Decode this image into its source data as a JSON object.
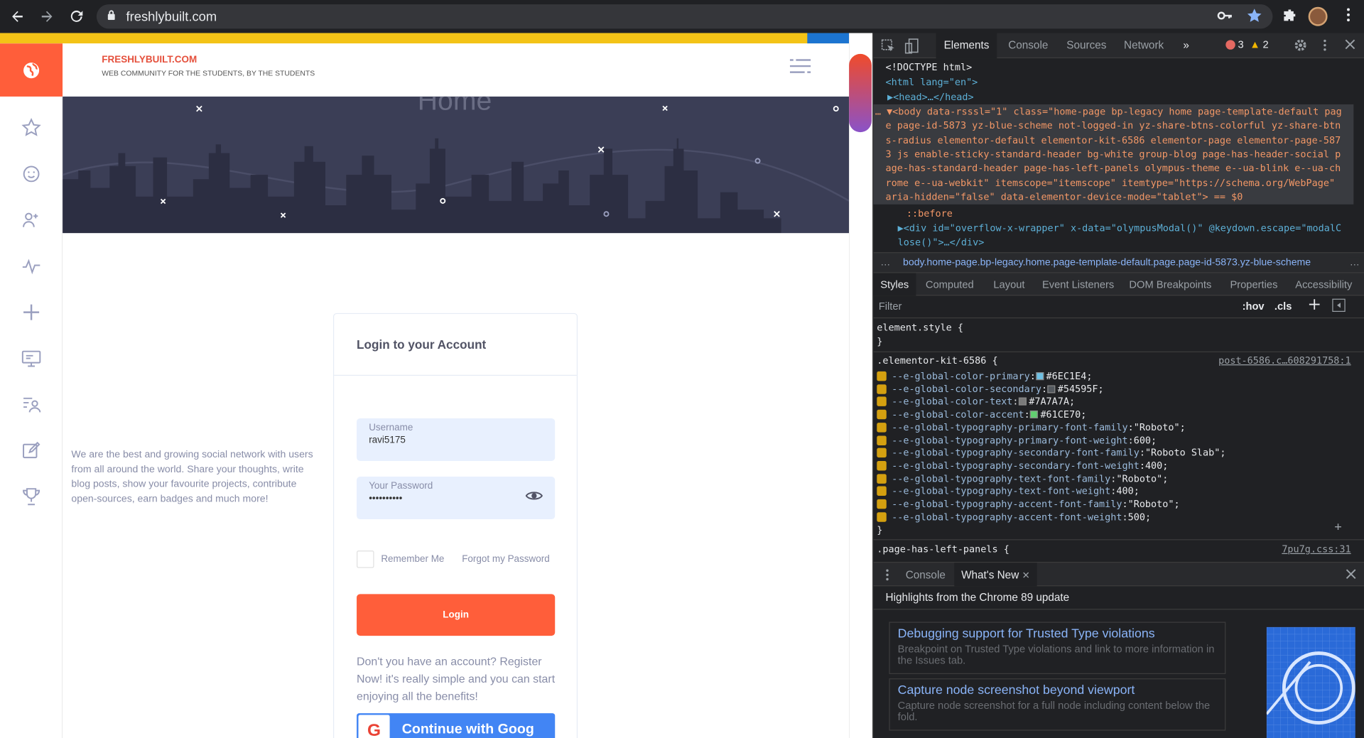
{
  "browser": {
    "url": "freshlybuilt.com"
  },
  "site": {
    "brand": "FRESHLYBUILT.COM",
    "tagline": "WEB COMMUNITY FOR THE STUDENTS, BY THE STUDENTS",
    "hero_title": "Home",
    "about": "We are the best and growing social network with users from all around the world. Share your thoughts, write blog posts, show your favourite projects, contribute open-sources, earn badges and much more!",
    "login": {
      "title": "Login to your Account",
      "username_label": "Username",
      "username_value": "ravi5175",
      "password_label": "Your Password",
      "password_value": "••••••••••",
      "remember": "Remember Me",
      "forgot": "Forgot my Password",
      "button": "Login",
      "register_text": "Don't you have an account? Register Now! it's really simple and you can start enjoying all the benefits!",
      "google_button": "Continue with Goog"
    },
    "colors": {
      "accent": "#ff5e3a",
      "hero": "#3b3e56",
      "topbar": "#f3c317"
    }
  },
  "devtools": {
    "tabs": [
      "Elements",
      "Console",
      "Sources",
      "Network"
    ],
    "active_tab": "Elements",
    "more_tabs": "»",
    "errors": "3",
    "warnings": "2",
    "elements_lines": [
      "<!DOCTYPE html>",
      "<html lang=\"en\">",
      "▶<head>…</head>",
      "… ▼<body data-rsssl=\"1\" class=\"home-page bp-legacy home page-template-default pag",
      "e page-id-5873 yz-blue-scheme not-logged-in yz-share-btns-colorful yz-share-btn",
      "s-radius elementor-default elementor-kit-6586 elementor-page elementor-page-587",
      "3 js enable-sticky-standard-header bg-white group-blog page-has-header-social p",
      "age-has-standard-header page-has-left-panels olympus-theme e--ua-blink e--ua-ch",
      "rome e--ua-webkit\" itemscope=\"itemscope\" itemtype=\"https://schema.org/WebPage\"",
      "aria-hidden=\"false\" data-elementor-device-mode=\"tablet\"> == $0",
      "::before",
      "▶<div id=\"overflow-x-wrapper\" x-data=\"olympusModal()\" @keydown.escape=\"modalC",
      "lose()\">…</div>"
    ],
    "breadcrumb": "body.home-page.bp-legacy.home.page-template-default.page.page-id-5873.yz-blue-scheme",
    "breadcrumb_lead": "…",
    "breadcrumb_trail": "…",
    "sub_tabs": [
      "Styles",
      "Computed",
      "Layout",
      "Event Listeners",
      "DOM Breakpoints",
      "Properties",
      "Accessibility"
    ],
    "filter_placeholder": "Filter",
    "hov": ":hov",
    "cls": ".cls",
    "element_style": "element.style {",
    "close_brace": "}",
    "rule_selector": ".elementor-kit-6586",
    "rule_source": "post-6586.c…608291758:1",
    "props": [
      {
        "name": "--e-global-color-primary",
        "value": "#6EC1E4",
        "color": "#6EC1E4"
      },
      {
        "name": "--e-global-color-secondary",
        "value": "#54595F",
        "color": "#54595F"
      },
      {
        "name": "--e-global-color-text",
        "value": "#7A7A7A",
        "color": "#7A7A7A"
      },
      {
        "name": "--e-global-color-accent",
        "value": "#61CE70",
        "color": "#61CE70"
      },
      {
        "name": "--e-global-typography-primary-font-family",
        "value": "\"Roboto\""
      },
      {
        "name": "--e-global-typography-primary-font-weight",
        "value": "600"
      },
      {
        "name": "--e-global-typography-secondary-font-family",
        "value": "\"Roboto Slab\""
      },
      {
        "name": "--e-global-typography-secondary-font-weight",
        "value": "400"
      },
      {
        "name": "--e-global-typography-text-font-family",
        "value": "\"Roboto\""
      },
      {
        "name": "--e-global-typography-text-font-weight",
        "value": "400"
      },
      {
        "name": "--e-global-typography-accent-font-family",
        "value": "\"Roboto\""
      },
      {
        "name": "--e-global-typography-accent-font-weight",
        "value": "500"
      }
    ],
    "next_selector": ".page-has-left-panels {",
    "next_source": "7pu7g.css:31",
    "drawer_tabs": [
      "Console",
      "What's New"
    ],
    "drawer_heading": "Highlights from the Chrome 89 update",
    "whats_new": [
      {
        "title": "Debugging support for Trusted Type violations",
        "desc": "Breakpoint on Trusted Type violations and link to more information in the Issues tab."
      },
      {
        "title": "Capture node screenshot beyond viewport",
        "desc": "Capture node screenshot for a full node including content below the fold."
      }
    ]
  }
}
